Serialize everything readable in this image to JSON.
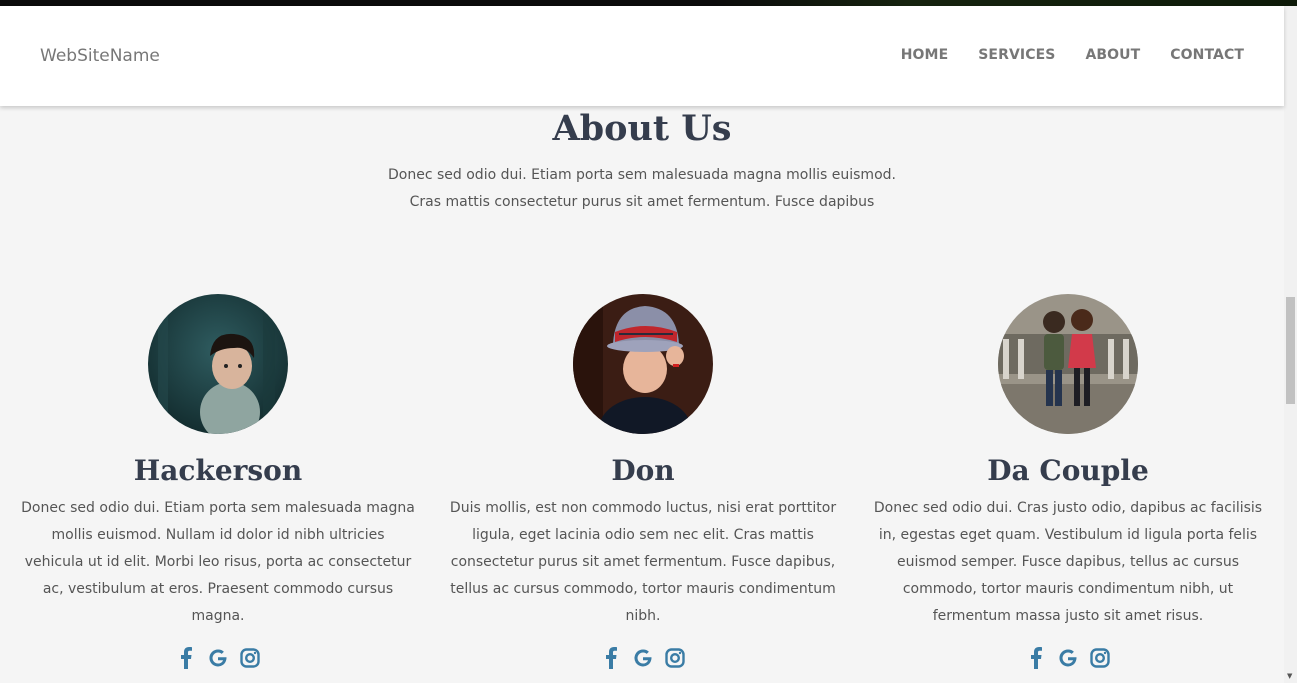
{
  "brand": "WebSiteName",
  "nav": [
    "HOME",
    "SERVICES",
    "ABOUT",
    "CONTACT"
  ],
  "about": {
    "title": "About Us",
    "desc_line1": "Donec sed odio dui. Etiam porta sem malesuada magna mollis euismod.",
    "desc_line2": "Cras mattis consectetur purus sit amet fermentum. Fusce dapibus"
  },
  "members": [
    {
      "name": "Hackerson",
      "bio": "Donec sed odio dui. Etiam porta sem malesuada magna mollis euismod. Nullam id dolor id nibh ultricies vehicula ut id elit. Morbi leo risus, porta ac consectetur ac, vestibulum at eros. Praesent commodo cursus magna."
    },
    {
      "name": "Don",
      "bio": "Duis mollis, est non commodo luctus, nisi erat porttitor ligula, eget lacinia odio sem nec elit. Cras mattis consectetur purus sit amet fermentum. Fusce dapibus, tellus ac cursus commodo, tortor mauris condimentum nibh."
    },
    {
      "name": "Da Couple",
      "bio": "Donec sed odio dui. Cras justo odio, dapibus ac facilisis in, egestas eget quam. Vestibulum id ligula porta felis euismod semper. Fusce dapibus, tellus ac cursus commodo, tortor mauris condimentum nibh, ut fermentum massa justo sit amet risus."
    }
  ],
  "social_icons": [
    "facebook-icon",
    "google-icon",
    "instagram-icon"
  ],
  "colors": {
    "heading": "#353d4d",
    "social": "#3a7ca5",
    "nav": "#777777"
  }
}
